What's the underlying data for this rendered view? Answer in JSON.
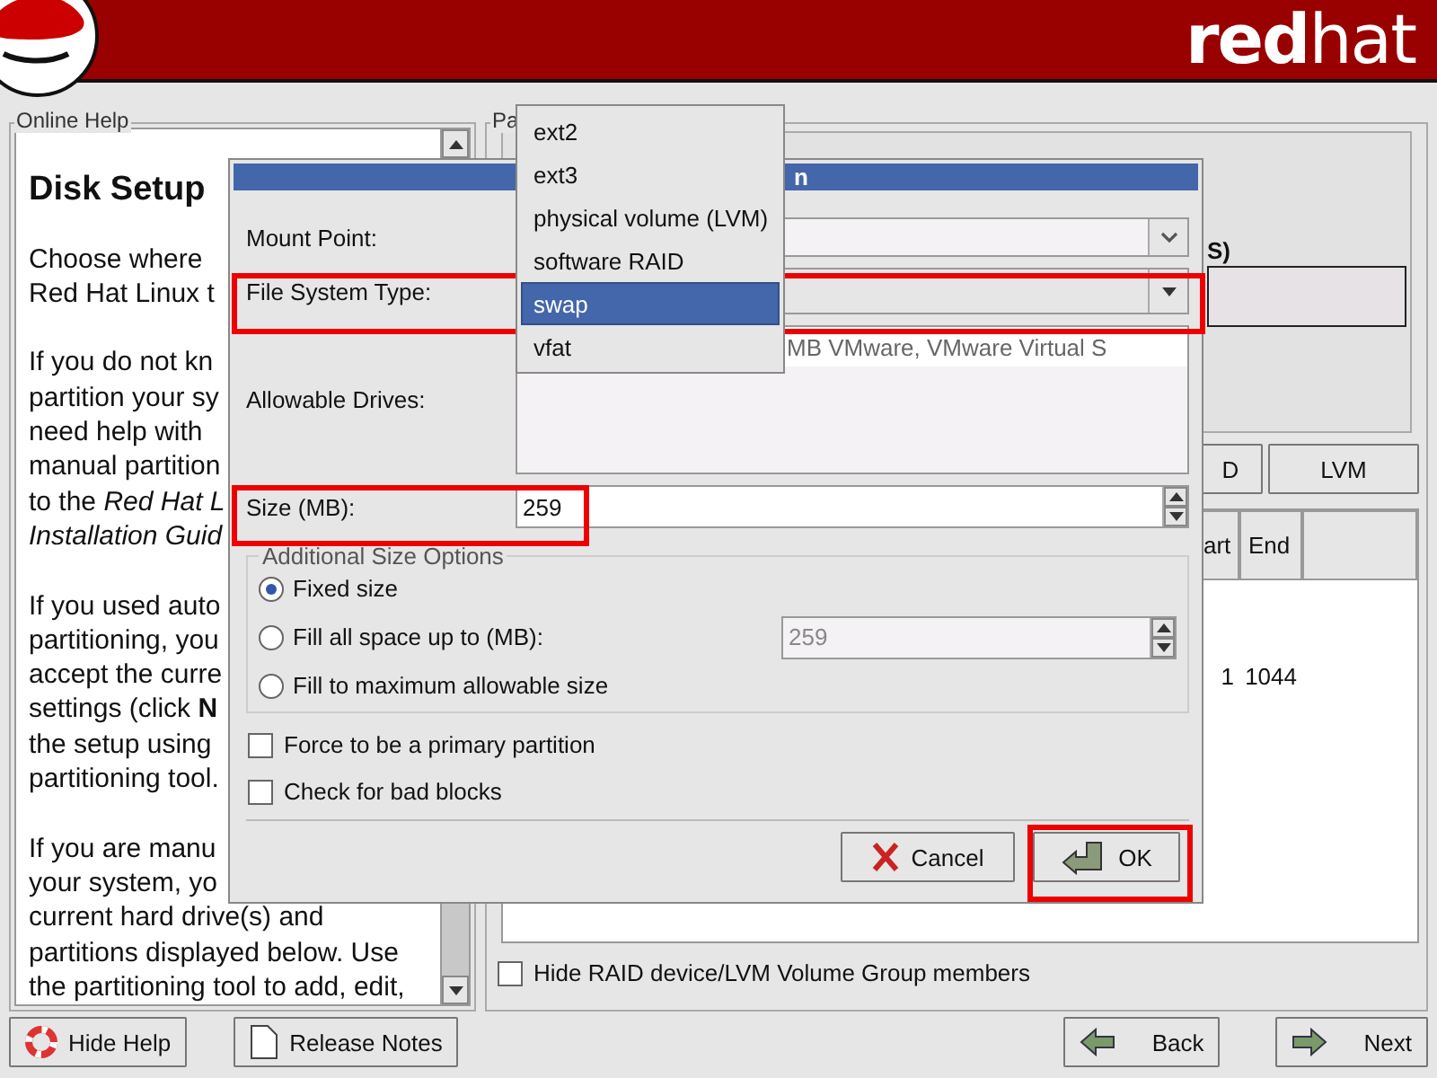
{
  "header": {
    "logo_text": "**red**hat"
  },
  "help": {
    "title": "Online Help",
    "heading": "Disk Setup",
    "paragraphs": [
      [
        {
          "text": "Choose where",
          "italic": false
        },
        {
          "text": "Red Hat Linux t",
          "italic": false
        }
      ],
      [
        {
          "text": "If you do not kn",
          "italic": false
        },
        {
          "text": "partition your sy",
          "italic": false
        },
        {
          "text": "need help with",
          "italic": false
        },
        {
          "text": "manual partition",
          "italic": false
        },
        {
          "text": "to the *Red Hat L*",
          "italic": false
        },
        {
          "text": "Installation Guid",
          "italic": true
        }
      ],
      [
        {
          "text": "If you used auto",
          "italic": false
        },
        {
          "text": "partitioning, you",
          "italic": false
        },
        {
          "text": "accept the curre",
          "italic": false
        },
        {
          "text": "settings (click **N**",
          "italic": false
        },
        {
          "text": "the setup using",
          "italic": false
        },
        {
          "text": "partitioning tool.",
          "italic": false
        }
      ],
      [
        {
          "text": "If you are manu",
          "italic": false
        },
        {
          "text": "your system, yo",
          "italic": false
        },
        {
          "text": "current hard drive(s) and",
          "italic": false
        },
        {
          "text": "partitions displayed below. Use",
          "italic": false
        },
        {
          "text": "the partitioning tool to add, edit,",
          "italic": false
        }
      ]
    ]
  },
  "partitions": {
    "title": "Pa",
    "drive_label": "S)",
    "buttons": [
      "D",
      "LVM"
    ],
    "columns": [
      "art",
      "End"
    ],
    "rows": [
      [
        "1",
        "1044"
      ]
    ],
    "hide_raid": {
      "label": "Hide RAID device/LVM Volume Group members",
      "checked": false
    }
  },
  "dialog": {
    "title": "n",
    "mount_point": {
      "label": "Mount Point:"
    },
    "fs_type": {
      "label": "File System Type:",
      "highlighted": true
    },
    "drives": {
      "label": "Allowable Drives:",
      "rows": [
        "MB  VMware, VMware Virtual S"
      ]
    },
    "size": {
      "label": "Size (MB):",
      "value": "259",
      "highlighted": true
    },
    "size_options": {
      "title": "Additional Size Options",
      "options": [
        {
          "label": "Fixed size",
          "selected": true
        },
        {
          "label": "Fill all space up to (MB):",
          "selected": false,
          "value": "259",
          "disabled": true
        },
        {
          "label": "Fill to maximum allowable size",
          "selected": false
        }
      ]
    },
    "checks": [
      {
        "label": "Force to be a primary partition",
        "checked": false
      },
      {
        "label": "Check for bad blocks",
        "checked": false
      }
    ],
    "buttons": [
      {
        "label": "Cancel",
        "kind": "cancel",
        "highlighted": false
      },
      {
        "label": "OK",
        "kind": "ok",
        "highlighted": true
      }
    ]
  },
  "dropdown": {
    "items": [
      {
        "label": "ext2",
        "selected": false
      },
      {
        "label": "ext3",
        "selected": false
      },
      {
        "label": "physical volume (LVM)",
        "selected": false
      },
      {
        "label": "software RAID",
        "selected": false
      },
      {
        "label": "swap",
        "selected": true
      },
      {
        "label": "vfat",
        "selected": false
      }
    ]
  },
  "footer": {
    "left": [
      {
        "label": "Hide Help",
        "kind": "help"
      },
      {
        "label": "Release Notes",
        "kind": "notes"
      }
    ],
    "right": [
      {
        "label": "Back",
        "kind": "back"
      },
      {
        "label": "Next",
        "kind": "next"
      }
    ]
  }
}
